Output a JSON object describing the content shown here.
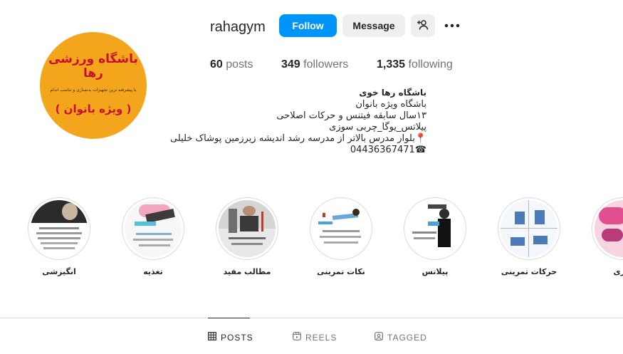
{
  "profile": {
    "username": "rahagym",
    "avatar_title": "باشگاه ورزشی رها",
    "avatar_subtitle": "با پیشرفته ترین تجهیزات بدنسازی و تناسب اندام",
    "avatar_tag": "( ویژه بانوان )",
    "follow_label": "Follow",
    "message_label": "Message"
  },
  "stats": {
    "posts_count": "60",
    "posts_label": "posts",
    "followers_count": "349",
    "followers_label": "followers",
    "following_count": "1,335",
    "following_label": "following"
  },
  "bio": {
    "name": "باشگاه رها خوی",
    "lines": [
      "باشگاه ویژه بانوان",
      "۱۳سال سابقه فیتنس و حرکات اصلاحی",
      "پیلاتس_یوگا_چربی سوزی",
      "📍بلوار مدرس بالاتر از مدرسه رشد اندیشه زیرزمین پوشاک خلیلی",
      "☎04436367471"
    ]
  },
  "highlights": [
    {
      "label": "انگیزشی"
    },
    {
      "label": "تغذیه"
    },
    {
      "label": "مطالب مفید"
    },
    {
      "label": "نکات تمرینی"
    },
    {
      "label": "پیلاتس"
    },
    {
      "label": "حرکات تمرینی"
    },
    {
      "label": "کاری"
    }
  ],
  "tabs": [
    {
      "label": "POSTS"
    },
    {
      "label": "REELS"
    },
    {
      "label": "TAGGED"
    }
  ],
  "colors": {
    "accent": "#0095f6",
    "avatar_bg": "#f3a51c",
    "avatar_text": "#c8102e"
  }
}
